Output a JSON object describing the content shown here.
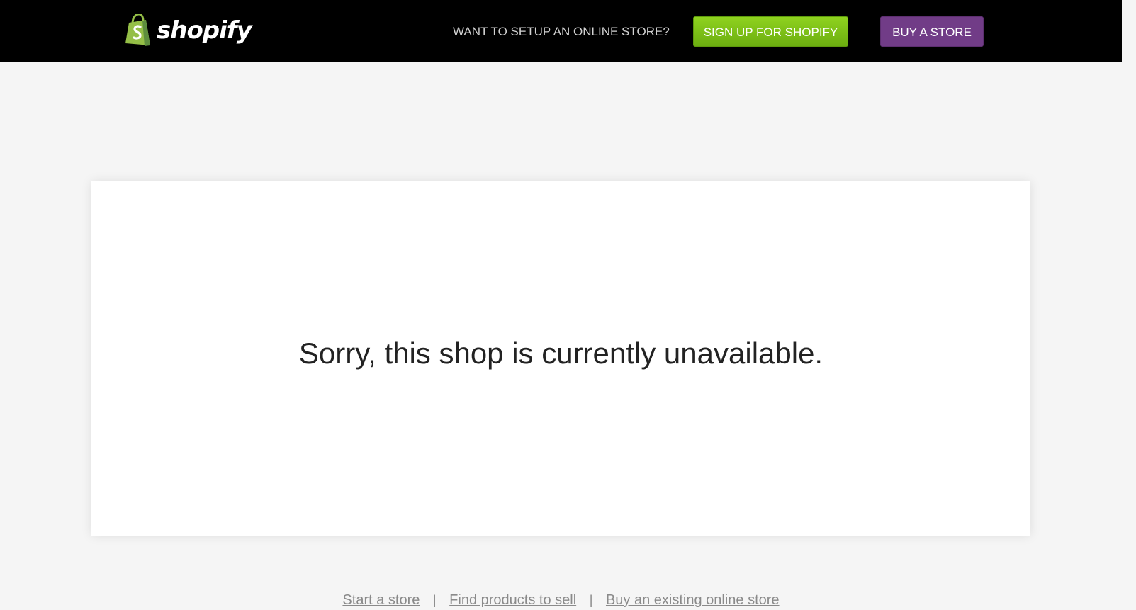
{
  "header": {
    "logo_text": "shopify",
    "promo_text": "WANT TO SETUP AN ONLINE STORE?",
    "signup_button": "SIGN UP FOR SHOPIFY",
    "buy_button": "BUY A STORE"
  },
  "main": {
    "message": "Sorry, this shop is currently unavailable."
  },
  "footer": {
    "links": [
      {
        "label": "Start a store"
      },
      {
        "label": "Find products to sell"
      },
      {
        "label": "Buy an existing online store"
      }
    ],
    "separator": "|"
  },
  "colors": {
    "topbar": "#000000",
    "signup_green": "#7cc017",
    "buy_purple": "#713c87",
    "logo_green": "#95bf47",
    "page_background": "#f5f5f5"
  },
  "icons": {
    "logo": "shopify-bag-icon"
  }
}
